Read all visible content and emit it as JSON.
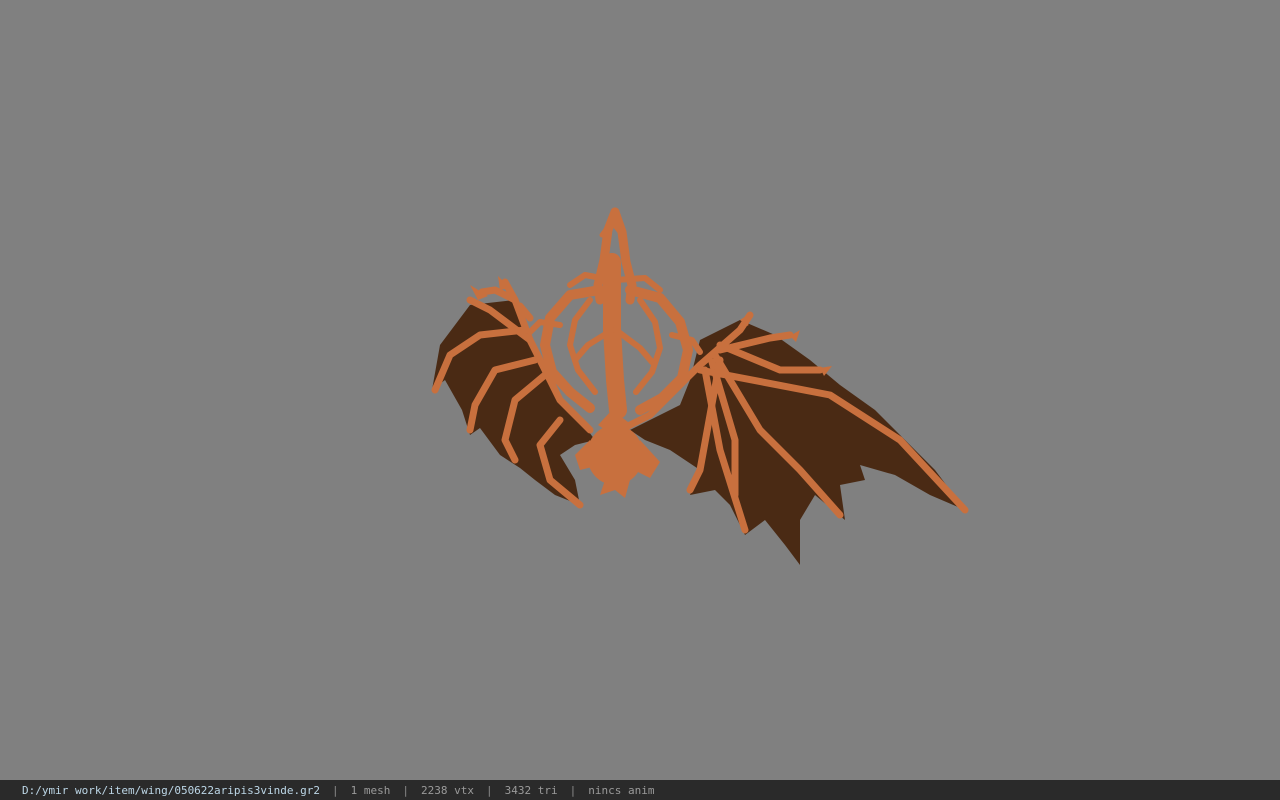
{
  "viewport": {
    "background_color": "#808080",
    "model_color": "#c8703e",
    "membrane_color": "#4a2a14",
    "model_icon": "dragon-wings-model-icon"
  },
  "statusbar": {
    "file_path": "D:/ymir work/item/wing/050622aripis3vinde.gr2",
    "separator": "|",
    "mesh_count": "1 mesh",
    "vertex_count": "2238 vtx",
    "triangle_count": "3432 tri",
    "anim_status": "nincs anim"
  }
}
